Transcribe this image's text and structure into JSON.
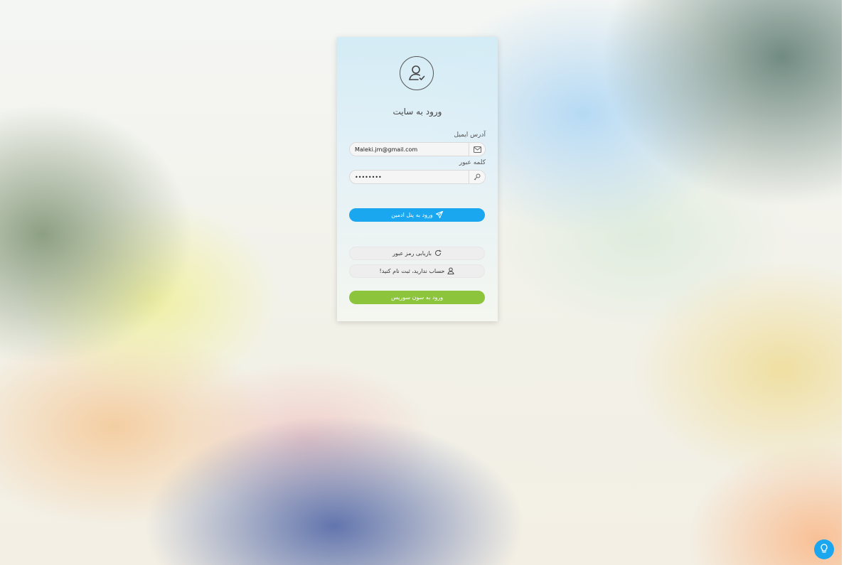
{
  "login": {
    "title": "ورود به سایت",
    "email_label": "آدرس ایمیل",
    "email_value": "Maleki.jm@gmail.com",
    "password_label": "کلمه عبور",
    "password_value": "••••••••",
    "admin_login_label": "ورود به پنل ادمین",
    "recover_password_label": "بازیابی رمز عبور",
    "register_label": "حساب ندارید، ثبت نام کنید!",
    "other_login_label": "ورود به سون سوریس"
  },
  "colors": {
    "primary": "#1aa7ef",
    "success": "#8cc43c"
  },
  "icons": {
    "avatar": "user-check-icon",
    "email": "envelope-icon",
    "password": "key-icon",
    "send": "paper-plane-icon",
    "refresh": "refresh-icon",
    "user": "user-icon",
    "help": "lightbulb-icon"
  }
}
